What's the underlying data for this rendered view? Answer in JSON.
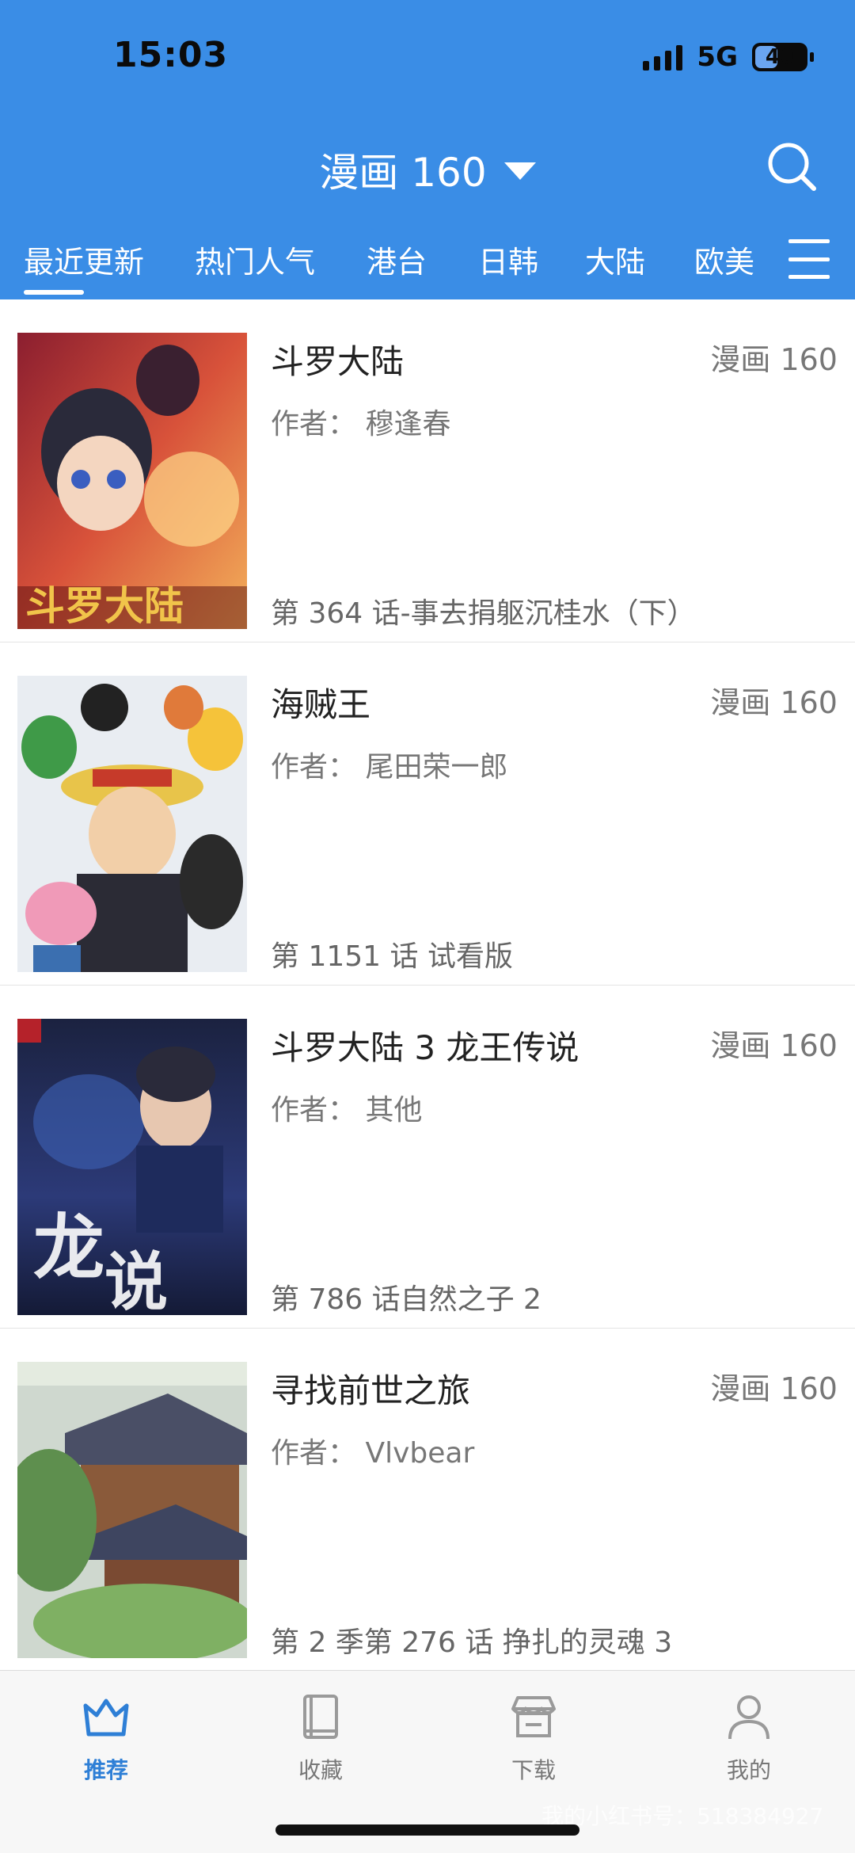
{
  "status_bar": {
    "time": "15:03",
    "network": "5G",
    "battery": "40"
  },
  "header": {
    "title": "漫画 160"
  },
  "tabs": [
    "最近更新",
    "热门人气",
    "港台",
    "日韩",
    "大陆",
    "欧美"
  ],
  "comics": [
    {
      "title": "斗罗大陆",
      "source": "漫画 160",
      "author": "作者：  穆逢春",
      "latest": "第 364 话-事去捐躯沉桂水（下）"
    },
    {
      "title": "海贼王",
      "source": "漫画 160",
      "author": "作者：  尾田荣一郎",
      "latest": "第 1151 话 试看版"
    },
    {
      "title": "斗罗大陆 3 龙王传说",
      "source": "漫画 160",
      "author": "作者：  其他",
      "latest": "第 786 话自然之子 2"
    },
    {
      "title": "寻找前世之旅",
      "source": "漫画 160",
      "author": "作者：  Vlvbear",
      "latest": "第 2 季第 276 话 挣扎的灵魂 3"
    }
  ],
  "tabbar": {
    "items": [
      "推荐",
      "收藏",
      "下载",
      "我的"
    ]
  },
  "watermark": "我的小红书号：518384927",
  "colors": {
    "primary": "#3a8de6",
    "tab_active": "#2e7fd6"
  }
}
